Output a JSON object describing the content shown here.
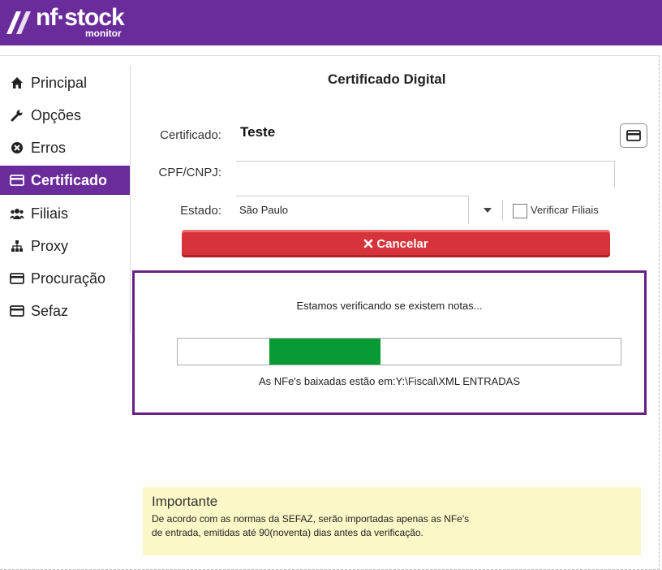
{
  "header": {
    "brand": "nf·stock",
    "sub": "monitor",
    "logo_icon": "nfstock-logo-mark",
    "bg_color": "#6a2c9b"
  },
  "sidebar": {
    "items": [
      {
        "label": "Principal",
        "icon": "home-icon"
      },
      {
        "label": "Opções",
        "icon": "wrench-icon"
      },
      {
        "label": "Erros",
        "icon": "error-circle-icon"
      },
      {
        "label": "Certificado",
        "icon": "credit-card-icon",
        "active": true
      },
      {
        "label": "Filiais",
        "icon": "users-icon"
      },
      {
        "label": "Proxy",
        "icon": "sitemap-icon"
      },
      {
        "label": "Procuração",
        "icon": "credit-card-icon"
      },
      {
        "label": "Sefaz",
        "icon": "credit-card-icon"
      }
    ],
    "active_color": "#6a2c9b"
  },
  "main": {
    "title": "Certificado Digital",
    "certificado_label": "Certificado:",
    "certificado_value": "Teste",
    "cpf_label": "CPF/CNPJ:",
    "cpf_value": "",
    "estado_label": "Estado:",
    "estado_value": "São Paulo",
    "verificar_filiais_label": "Verificar Filiais",
    "verificar_filiais_checked": false,
    "cancel_label": "Cancelar",
    "cancel_color": "#d6343a"
  },
  "progress": {
    "message": "Estamos verificando se existem notas...",
    "path_message": "As NFe's baixadas estão em:Y:\\Fiscal\\XML ENTRADAS",
    "fill_start_fraction": 0.207,
    "fill_fraction": 0.25,
    "fill_color": "#079a35",
    "border_color": "#6a1f86"
  },
  "note": {
    "title": "Importante",
    "line1": "De acordo com as normas da SEFAZ, serão importadas apenas as NFe's",
    "line2": "de entrada, emitidas até 90(noventa) dias antes da verificação."
  }
}
